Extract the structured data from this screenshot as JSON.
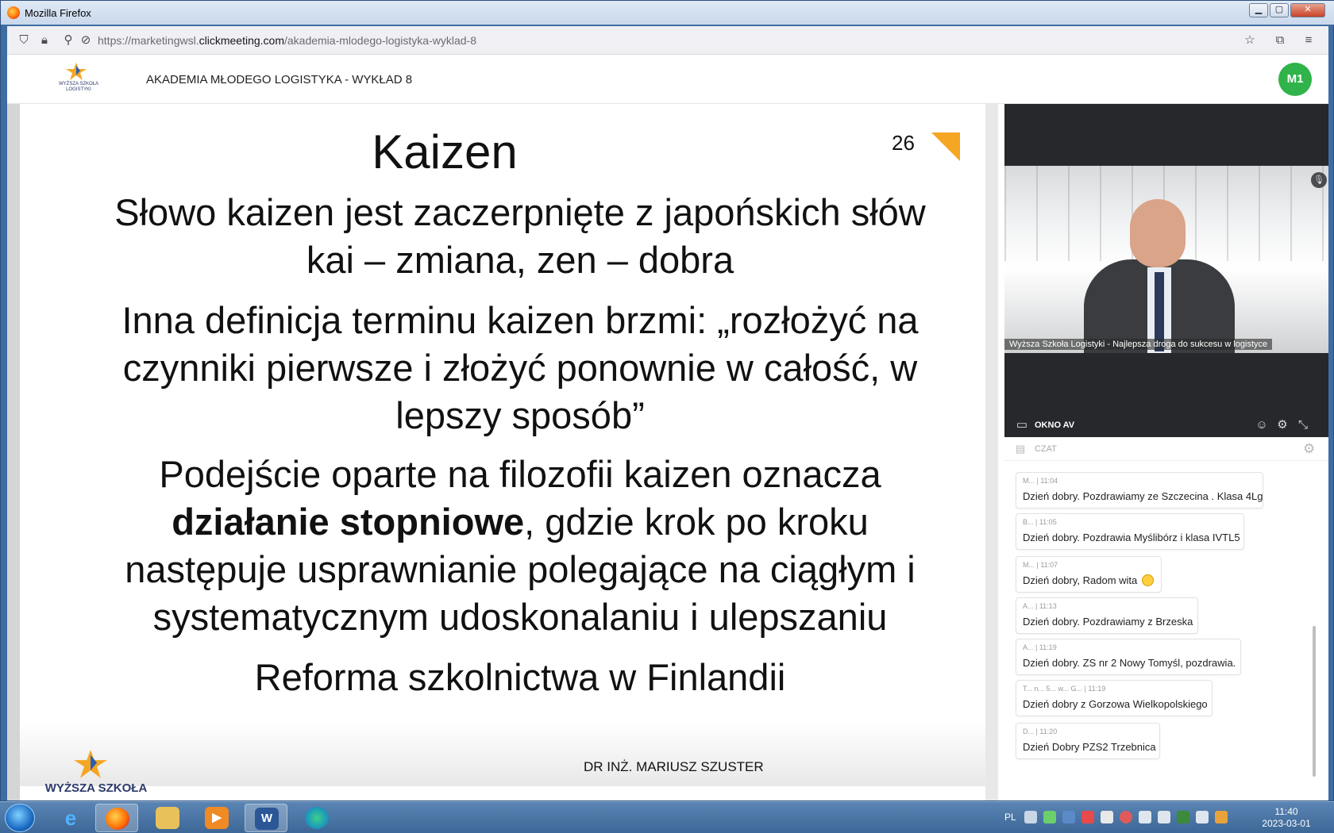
{
  "window": {
    "title": "Mozilla Firefox",
    "minimize": "▁",
    "maximize": "▢",
    "close": "✕"
  },
  "browser": {
    "url_prefix": "https://marketingwsl.",
    "url_domain": "clickmeeting.com",
    "url_path": "/akademia-mlodego-logistyka-wyklad-8"
  },
  "header": {
    "logo_text_line1": "WYŻSZA SZKOŁA",
    "logo_text_line2": "LOGISTYKI",
    "event_title": "AKADEMIA MŁODEGO LOGISTYKA - WYKŁAD 8",
    "avatar_initials": "M1"
  },
  "slide": {
    "title": "Kaizen",
    "page_number": "26",
    "paragraph1_line1": "Słowo kaizen jest zaczerpnięte z japońskich słów",
    "paragraph1_line2": "kai – zmiana, zen – dobra",
    "paragraph2_line1": "Inna definicja terminu kaizen brzmi: „rozłożyć na",
    "paragraph2_line2": "czynniki pierwsze i złożyć ponownie w całość, w",
    "paragraph2_line3": "lepszy sposób”",
    "paragraph3_line1": "Podejście oparte na filozofii kaizen oznacza",
    "paragraph3_bold": "działanie stopniowe",
    "paragraph3_line2_rest": ", gdzie krok po kroku",
    "paragraph3_line3": "następuje usprawnianie polegające na ciągłym i",
    "paragraph3_line4": "systematycznym udoskonalaniu i ulepszaniu",
    "paragraph4": "Reforma szkolnictwa w Finlandii",
    "footer_logo_text": "WYŻSZA SZKOŁA",
    "footer_author": "DR INŻ. MARIUSZ SZUSTER"
  },
  "av_panel": {
    "video_caption": "Wyższa Szkoła Logistyki - Najlepsza droga do sukcesu w logistyce",
    "label": "OKNO AV"
  },
  "chat": {
    "label": "CZAT",
    "messages": [
      {
        "meta": "M... | 11:04",
        "text": "Dzień dobry. Pozdrawiamy ze Szczecina . Klasa 4Lg"
      },
      {
        "meta": "B... | 11:05",
        "text": "Dzień dobry. Pozdrawia Myślibórz i klasa IVTL5"
      },
      {
        "meta": "M... | 11:07",
        "text": "Dzień dobry, Radom wita"
      },
      {
        "meta": "A... | 11:13",
        "text": "Dzień dobry. Pozdrawiamy z Brzeska"
      },
      {
        "meta": "A... | 11:19",
        "text": "Dzień dobry. ZS nr 2 Nowy Tomyśl, pozdrawia."
      },
      {
        "meta": "T... n... 5... w... G... | 11:19",
        "text": "Dzień dobry z Gorzowa Wielkopolskiego"
      },
      {
        "meta": "D... | 11:20",
        "text": "Dzień Dobry PZS2 Trzebnica"
      }
    ]
  },
  "taskbar": {
    "language": "PL",
    "time": "11:40",
    "date": "2023-03-01"
  },
  "colors": {
    "accent_orange": "#f5a623",
    "avatar_green": "#2fb34a",
    "logo_blue": "#2d3b6b"
  }
}
